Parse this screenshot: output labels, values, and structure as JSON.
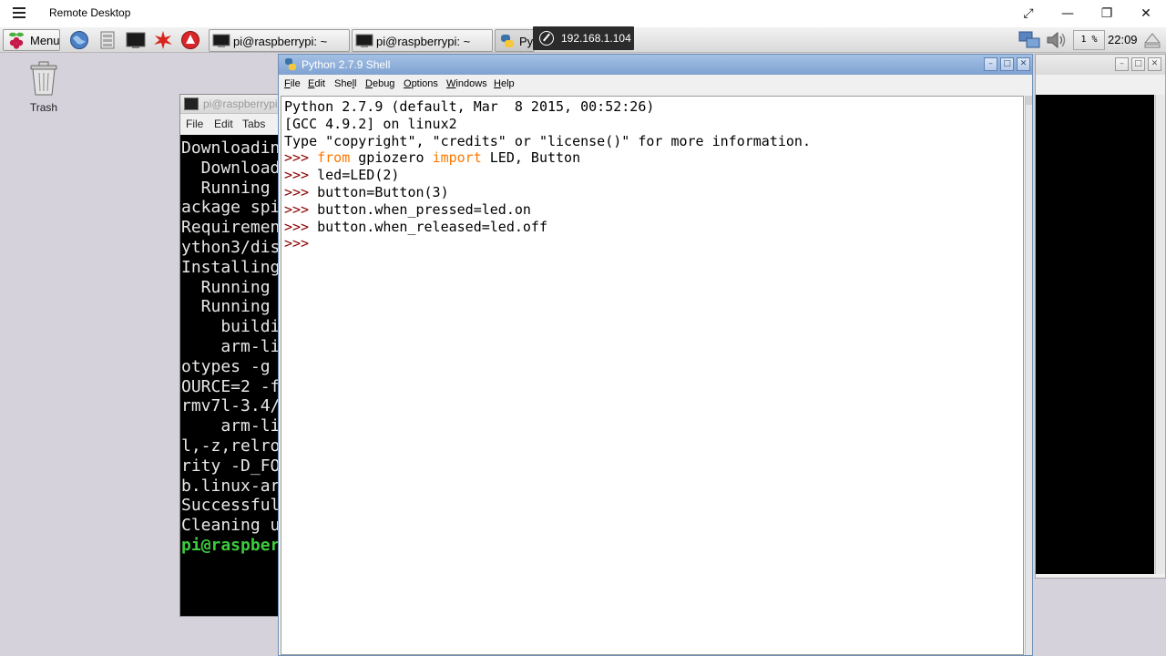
{
  "host": {
    "title": "Remote Desktop",
    "expand_glyph": "⤢",
    "minimize_glyph": "—",
    "restore_glyph": "❐",
    "close_glyph": "✕"
  },
  "connection_tip": {
    "ip": "192.168.1.104"
  },
  "panel": {
    "menu_label": "Menu",
    "tasks": [
      {
        "label": "pi@raspberrypi: ~"
      },
      {
        "label": "pi@raspberrypi: ~"
      },
      {
        "label": "Py"
      }
    ],
    "tray": {
      "cpu": "1 %",
      "clock": "22:09"
    }
  },
  "desktop": {
    "trash_label": "Trash"
  },
  "terminal": {
    "title": "pi@raspberrypi",
    "menu": [
      "File",
      "Edit",
      "Tabs"
    ],
    "lines": [
      "Downloading",
      "  Download",
      "  Running",
      "ackage spi",
      "",
      "Requiremen",
      "ython3/dis",
      "Installing",
      "  Running",
      "",
      "  Running",
      "    buildi",
      "    arm-li",
      "otypes -g",
      "OURCE=2 -f",
      "rmv7l-3.4/",
      "    arm-li",
      "l,-z,relro",
      "rity -D_FO",
      "b.linux-ar",
      "",
      "Successful",
      "Cleaning u"
    ],
    "prompt_line": "pi@raspber"
  },
  "idle": {
    "title": "Python 2.7.9 Shell",
    "menu": [
      {
        "label": "File",
        "u": "F",
        "rest": "ile"
      },
      {
        "label": "Edit",
        "u": "E",
        "rest": "dit"
      },
      {
        "label": "Shell",
        "pre": "She",
        "u": "l",
        "rest": "l"
      },
      {
        "label": "Debug",
        "u": "D",
        "rest": "ebug"
      },
      {
        "label": "Options",
        "u": "O",
        "rest": "ptions"
      },
      {
        "label": "Windows",
        "u": "W",
        "rest": "indows"
      },
      {
        "label": "Help",
        "u": "H",
        "rest": "elp"
      }
    ],
    "banner": [
      "Python 2.7.9 (default, Mar  8 2015, 00:52:26)",
      "[GCC 4.9.2] on linux2",
      "Type \"copyright\", \"credits\" or \"license()\" for more information."
    ],
    "prompt": ">>>",
    "commands": {
      "c1_kw1": "from",
      "c1_mod": " gpiozero ",
      "c1_kw2": "import",
      "c1_rest": " LED, Button",
      "c2": "led=LED(2)",
      "c3": "button=Button(3)",
      "c4": "button.when_pressed=led.on",
      "c5": "button.when_released=led.off"
    }
  },
  "colors": {
    "idle_title_bar": "#8aaad8",
    "prompt": "#8b0000",
    "keyword": "#ff7700",
    "terminal_ok": "#3ccd3c"
  }
}
